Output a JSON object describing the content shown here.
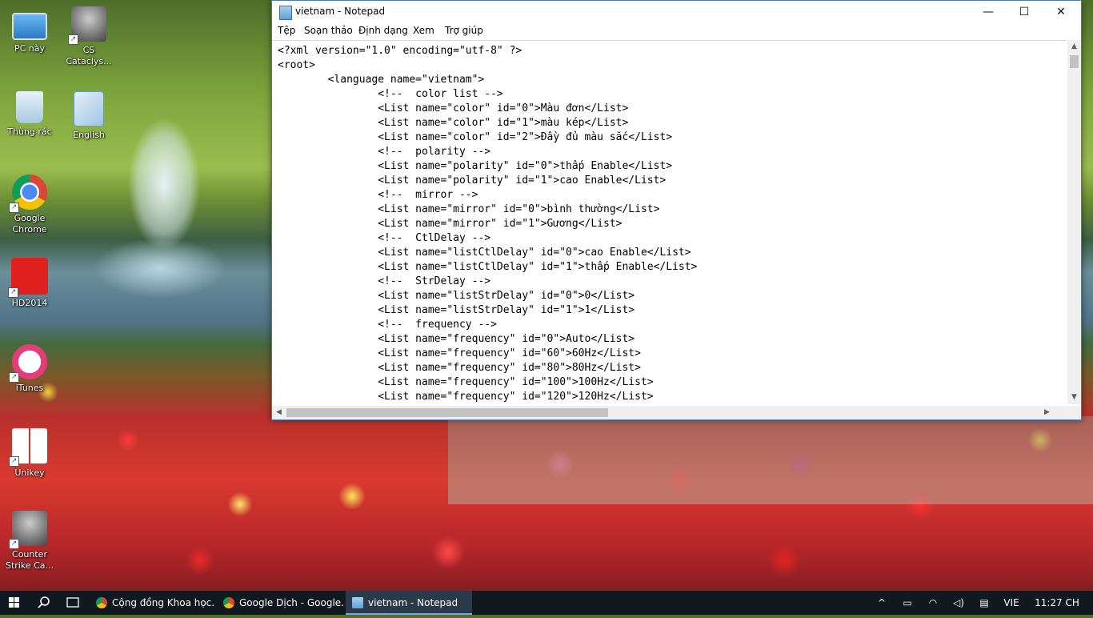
{
  "desktop": {
    "icons": [
      {
        "label": "PC này"
      },
      {
        "label": "CS\nCataclys..."
      },
      {
        "label": "Thùng rác"
      },
      {
        "label": "English"
      },
      {
        "label": "Google\nChrome"
      },
      {
        "label": "HD2014"
      },
      {
        "label": "iTunes"
      },
      {
        "label": "Unikey"
      },
      {
        "label": "Counter\nStrike Ca..."
      }
    ]
  },
  "window": {
    "title": "vietnam - Notepad",
    "controls": {
      "minimize": "—",
      "maximize": "☐",
      "close": "✕"
    },
    "menu": [
      "Tệp",
      "Soạn thảo",
      "Định dạng",
      "Xem",
      "Trợ giúp"
    ],
    "lines": [
      "<?xml version=\"1.0\" encoding=\"utf-8\" ?>",
      "<root>",
      "        <language name=\"vietnam\">",
      "                <!--  color list -->",
      "                <List name=\"color\" id=\"0\">Màu đơn</List>",
      "                <List name=\"color\" id=\"1\">màu kép</List>",
      "                <List name=\"color\" id=\"2\">Đầy đủ màu sắc</List>",
      "                <!--  polarity -->",
      "                <List name=\"polarity\" id=\"0\">thấp Enable</List>",
      "                <List name=\"polarity\" id=\"1\">cao Enable</List>",
      "                <!--  mirror -->",
      "                <List name=\"mirror\" id=\"0\">bình thường</List>",
      "                <List name=\"mirror\" id=\"1\">Gương</List>",
      "                <!--  CtlDelay -->",
      "                <List name=\"listCtlDelay\" id=\"0\">cao Enable</List>",
      "                <List name=\"listCtlDelay\" id=\"1\">thấp Enable</List>",
      "                <!--  StrDelay -->",
      "                <List name=\"listStrDelay\" id=\"0\">0</List>",
      "                <List name=\"listStrDelay\" id=\"1\">1</List>",
      "                <!--  frequency -->",
      "                <List name=\"frequency\" id=\"0\">Auto</List>",
      "                <List name=\"frequency\" id=\"60\">60Hz</List>",
      "                <List name=\"frequency\" id=\"80\">80Hz</List>",
      "                <List name=\"frequency\" id=\"100\">100Hz</List>",
      "                <List name=\"frequency\" id=\"120\">120Hz</List>"
    ],
    "scroll": {
      "up": "▲",
      "down": "▼",
      "left": "◀",
      "right": "▶"
    }
  },
  "taskbar": {
    "tasks": [
      {
        "label": "Cộng đồng Khoa học..."
      },
      {
        "label": "Google Dịch - Google..."
      },
      {
        "label": "vietnam - Notepad"
      }
    ],
    "tray": {
      "chevron": "^",
      "battery": "▭",
      "wifi": "◠",
      "volume": "◁)",
      "notification": "▤",
      "language": "VIE",
      "time": "11:27 CH"
    }
  }
}
